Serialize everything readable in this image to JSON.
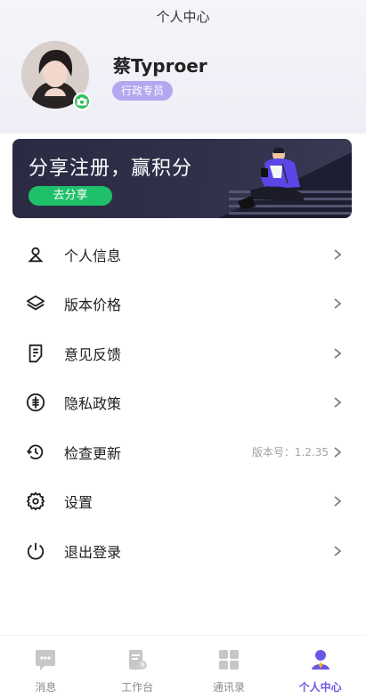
{
  "header": {
    "title": "个人中心"
  },
  "profile": {
    "name": "蔡Typroer",
    "role": "行政专员"
  },
  "banner": {
    "title": "分享注册，赢积分",
    "button_label": "去分享"
  },
  "menu": {
    "items": [
      {
        "label": "个人信息",
        "icon": "user-icon",
        "extra": ""
      },
      {
        "label": "版本价格",
        "icon": "layers-icon",
        "extra": ""
      },
      {
        "label": "意见反馈",
        "icon": "feedback-icon",
        "extra": ""
      },
      {
        "label": "隐私政策",
        "icon": "privacy-icon",
        "extra": ""
      },
      {
        "label": "检查更新",
        "icon": "update-icon",
        "extra": "版本号：1.2.35"
      },
      {
        "label": "设置",
        "icon": "gear-icon",
        "extra": ""
      },
      {
        "label": "退出登录",
        "icon": "power-icon",
        "extra": ""
      }
    ]
  },
  "tabbar": {
    "items": [
      {
        "label": "消息",
        "icon": "message-icon",
        "active": false
      },
      {
        "label": "工作台",
        "icon": "workbench-icon",
        "active": false
      },
      {
        "label": "通讯录",
        "icon": "contacts-icon",
        "active": false
      },
      {
        "label": "个人中心",
        "icon": "profile-icon",
        "active": true
      }
    ]
  },
  "colors": {
    "accent": "#6b57e6",
    "badge": "#b3a8f0",
    "share_button": "#1fc06a",
    "banner_bg": "#2a2a43"
  }
}
